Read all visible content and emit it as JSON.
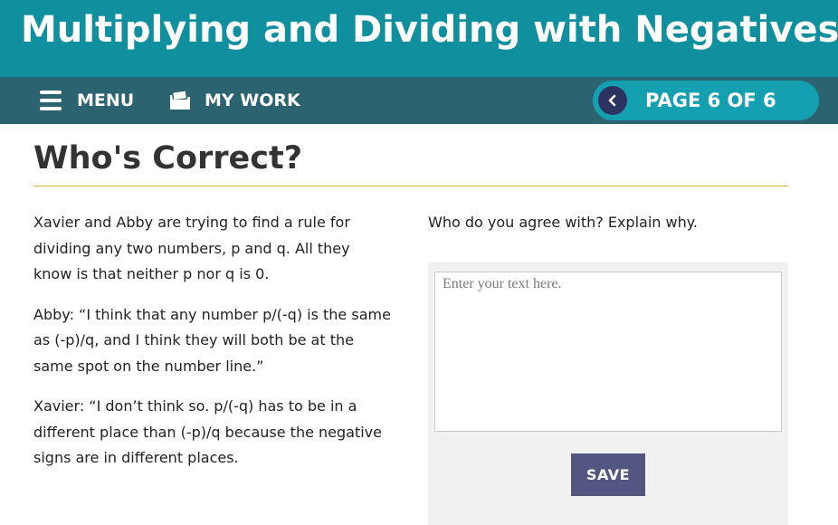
{
  "header": {
    "title": "Multiplying and Dividing with Negatives"
  },
  "nav": {
    "menu_label": "MENU",
    "my_work_label": "MY WORK",
    "page_indicator": "PAGE 6 OF 6"
  },
  "main": {
    "heading": "Who's Correct?",
    "paragraphs": [
      "Xavier and Abby are trying to find a rule for dividing any two numbers, p and q. All they know is that neither p nor q is 0.",
      "Abby: “I think that any number p/(-q) is the same as (-p)/q, and I think they will both be at the same spot on the number line.”",
      "Xavier: “I don’t think so. p/(-q) has to be in a different place than (-p)/q because the negative signs are in different places."
    ],
    "question": "Who do you agree with? Explain why.",
    "answer": {
      "value": "",
      "placeholder": "Enter your text here."
    },
    "save_label": "SAVE"
  },
  "icons": {
    "menu": "hamburger-icon",
    "my_work": "folder-icon",
    "previous_page": "chevron-left-icon"
  },
  "colors": {
    "title_bar": "#10909f",
    "nav_bar": "#2b6470",
    "page_pill": "#14a0b0",
    "prev_button": "#2d3360",
    "heading_rule": "#d4b62e",
    "save_button": "#545682"
  }
}
